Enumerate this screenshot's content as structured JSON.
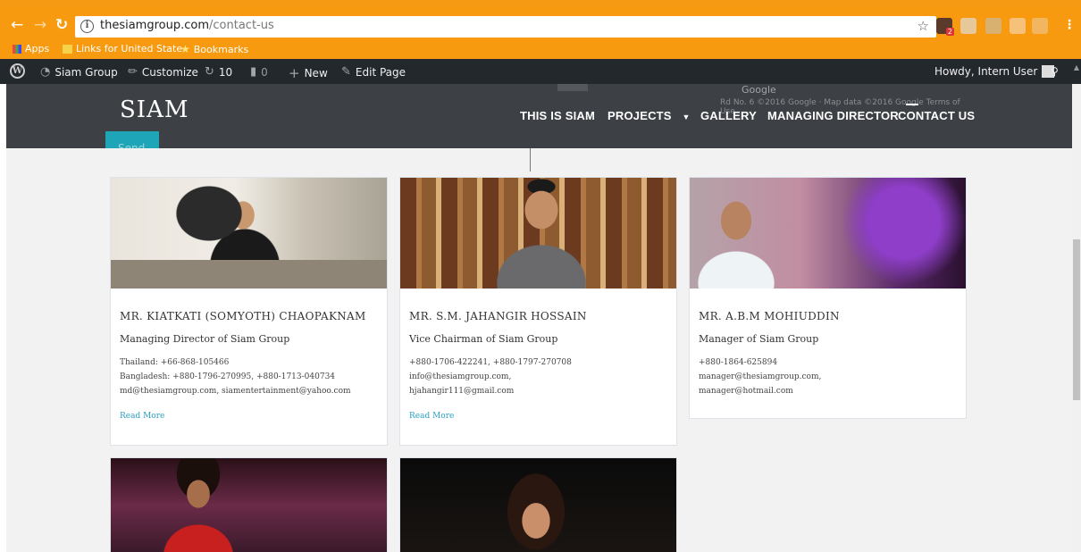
{
  "browser": {
    "url_domain": "thesiamgroup.com",
    "url_path": "/contact-us",
    "bookmarks": [
      {
        "label": "Apps"
      },
      {
        "label": "Links for United State"
      },
      {
        "label": "Bookmarks"
      }
    ],
    "extension_badge": "2"
  },
  "adminbar": {
    "site_name": "Siam Group",
    "customize": "Customize",
    "updates_count": "10",
    "comments_count": "0",
    "new_label": "New",
    "edit_page": "Edit Page",
    "howdy": "Howdy, Intern User"
  },
  "header": {
    "logo": "SIAM",
    "menu": [
      "THIS IS SIAM",
      "PROJECTS",
      "GALLERY",
      "MANAGING DIRECTOR",
      "CONTACT US"
    ],
    "map_ghost": "Rd No. 6   ©2016 Google · Map data ©2016 Google   Terms of Use",
    "map_google": "Google",
    "send_label": "Send"
  },
  "cards": [
    {
      "name": "MR. KIATKATI (SOMYOTH) CHAOPAKNAM",
      "role": "Managing Director of Siam Group",
      "lines": [
        "Thailand: +66-868-105466",
        "Bangladesh: +880-1796-270995, +880-1713-040734",
        "md@thesiamgroup.com, siamentertainment@yahoo.com"
      ],
      "read_more": "Read More"
    },
    {
      "name": "MR. S.M. JAHANGIR HOSSAIN",
      "role": "Vice Chairman of Siam Group",
      "lines": [
        "+880-1706-422241, +880-1797-270708",
        "info@thesiamgroup.com,",
        "hjahangir111@gmail.com"
      ],
      "read_more": "Read More"
    },
    {
      "name": "MR. A.B.M MOHIUDDIN",
      "role": "Manager of Siam Group",
      "lines": [
        "+880-1864-625894",
        "manager@thesiamgroup.com,",
        "manager@hotmail.com"
      ]
    }
  ],
  "colors": {
    "chrome_orange": "#f89a0f",
    "admin_bar": "#23282d",
    "header": "#3d4145",
    "link": "#2aa1c2",
    "send_button": "#1fa5b8"
  }
}
